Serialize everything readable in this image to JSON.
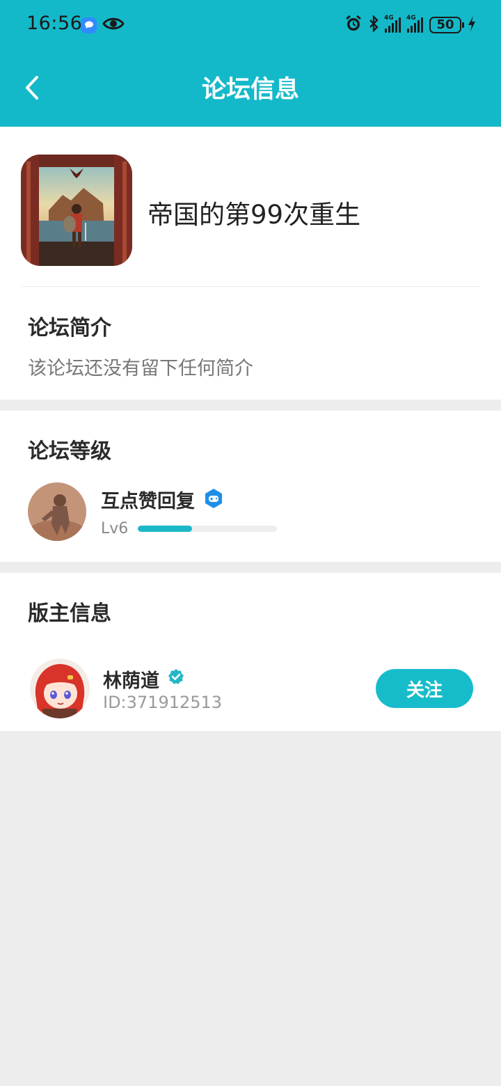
{
  "status_bar": {
    "time": "16:56",
    "battery": "50",
    "network_1": "4G",
    "network_2": "4G"
  },
  "header": {
    "title": "论坛信息"
  },
  "forum": {
    "name": "帝国的第99次重生"
  },
  "intro": {
    "title": "论坛简介",
    "text": "该论坛还没有留下任何简介"
  },
  "level": {
    "title": "论坛等级",
    "user_name": "互点赞回复",
    "level_label": "Lv6",
    "progress": 0.39
  },
  "moderator": {
    "title": "版主信息",
    "name": "林荫道",
    "id": "ID:371912513",
    "follow_label": "关注"
  },
  "colors": {
    "accent": "#14b9c9",
    "button": "#17bccb",
    "page_bg": "#ededed"
  }
}
